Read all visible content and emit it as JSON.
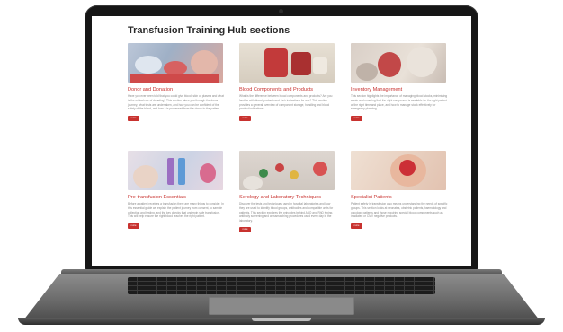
{
  "page": {
    "title": "Transfusion Training Hub sections"
  },
  "sections": [
    {
      "title": "Donor and Donation",
      "text": "Have you ever been told that you could give blood, skin or plasma and what is the critical role of donating? This section takes you through the donor journey, what tests are undertaken, and how you can be confident of the safety of the blood, and how it is processed from the donor to the patient.",
      "button": "more",
      "image_icon": "donor-image"
    },
    {
      "title": "Blood Components and Products",
      "text": "What is the difference between blood components and products? Are you familiar with blood products and their indications for use? This section provides a general overview of component storage, handling and blood product indications.",
      "button": "more",
      "image_icon": "blood-bag-image"
    },
    {
      "title": "Inventory Management",
      "text": "This section highlights the importance of managing blood stocks, minimising waste and ensuring that the right component is available for the right patient at the right time and place, and how to manage stock effectively for emergency planning.",
      "button": "more",
      "image_icon": "inventory-image"
    },
    {
      "title": "Pre-transfusion Essentials",
      "text": "Before a patient receives a transfusion there are many things to consider. In this essential guide we explain the patient journey from consent, to sample collection and testing, and the key checks that underpin safe transfusion. This will help ensure the right blood reaches the right patient.",
      "button": "more",
      "image_icon": "sample-tubes-image"
    },
    {
      "title": "Serology and Laboratory Techniques",
      "text": "Discover the tests and techniques used in hospital laboratories and how they are used to identify blood groups, antibodies and compatible units for patients. This section explores the principles behind ABO and RhD typing, antibody screening and crossmatching procedures used every day in the laboratory.",
      "button": "more",
      "image_icon": "lab-image"
    },
    {
      "title": "Specialist Patients",
      "text": "Patient safety in transfusion also means understanding the needs of specific groups. This section looks at neonates, obstetric patients, haematology and oncology patients and those requiring special blood components such as irradiated or CMV negative products.",
      "button": "more",
      "image_icon": "hands-heart-image"
    }
  ]
}
